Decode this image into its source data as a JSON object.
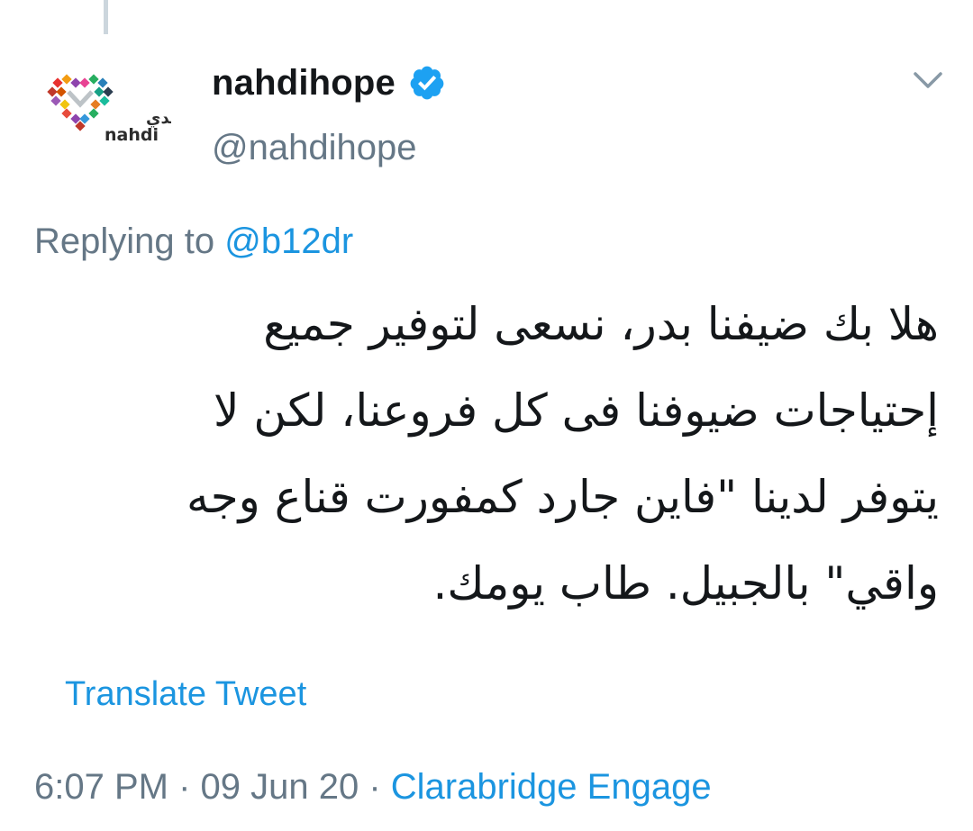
{
  "account": {
    "display_name": "nahdihope",
    "handle": "@nahdihope",
    "verified_icon": "verified-badge-icon",
    "avatar_logo_arabic": "النهدي",
    "avatar_logo_latin": "nahdi"
  },
  "reply": {
    "prefix": "Replying to",
    "mention": "@b12dr"
  },
  "tweet": {
    "lines": [
      "هلا بك ضيفنا بدر، نسعى لتوفير جميع",
      "إحتياجات ضيوفنا فى كل فروعنا، لكن لا",
      "يتوفر لدينا \"فاين جارد كمفورت قناع وجه",
      "واقي\" بالجبيل. طاب يومك."
    ]
  },
  "translate_label": "Translate Tweet",
  "meta": {
    "time": "6:07 PM",
    "sep1": " · ",
    "date": "09 Jun 20",
    "sep2": " · ",
    "source": "Clarabridge Engage"
  },
  "colors": {
    "link": "#1b95e0",
    "secondary": "#657786",
    "text": "#14171a",
    "thread_line": "#ccd6dd"
  }
}
